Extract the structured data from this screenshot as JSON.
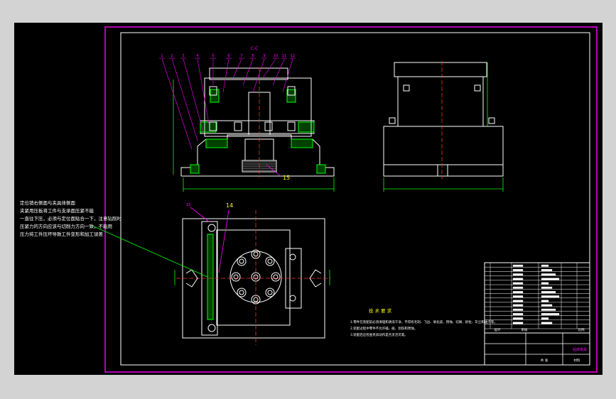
{
  "colors": {
    "background": "#000000",
    "viewport_border": "#d3d3d3",
    "sheet_border": "#ff00ff",
    "drawing": "#ffffff",
    "dimension": "#00ff00",
    "leader": "#ff00ff",
    "centerline": "#ff3030",
    "text": "#ffffff",
    "highlight_text": "#ffff00"
  },
  "section_label": "C-C",
  "part_numbers_top": [
    "1",
    "2",
    "3",
    "4",
    "5",
    "6",
    "7",
    "8",
    "9",
    "10",
    "11",
    "12"
  ],
  "balloon_15": "15",
  "balloon_13": "13",
  "balloon_14": "14",
  "note_lines": [
    "定位销右侧面与夹具体侧面",
    "夹紧用压板将工件与支承面压紧不能",
    "一直往下压，必须与定位面贴合一下，注意钻削时",
    "压紧力的方向应该与切削力方向一致，不能用",
    "压力将工件压坏导致工件变形和加工误差"
  ],
  "tech_title": "技 术 要 求",
  "tech_lines": [
    "1.零件在装配前必须清理和清洗干净，不得有毛刺、飞边、氧化皮、锈蚀、切屑、砂粒、灰尘和油污等。",
    "2.装配过程中零件不允许磕、碰、划伤和锈蚀。",
    "3.装配后应检查夹具动作是否灵活可靠。"
  ],
  "title_block": {
    "drawing_name": "钻床夹具",
    "label_design": "设计",
    "label_check": "审核",
    "label_scale": "比例",
    "label_sheet": "共  张",
    "label_material": "材料"
  }
}
